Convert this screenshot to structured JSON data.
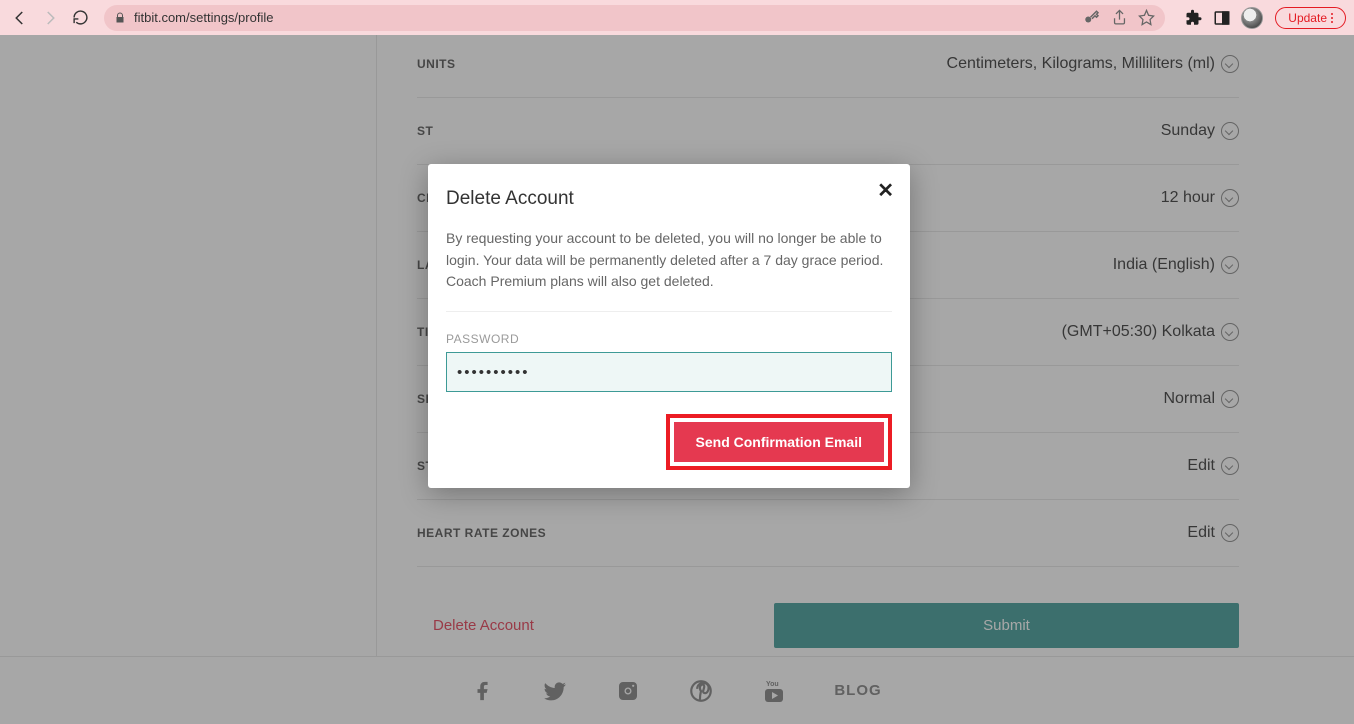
{
  "browser": {
    "url": "fitbit.com/settings/profile",
    "update_label": "Update"
  },
  "settings": [
    {
      "label": "UNITS",
      "value": "Centimeters, Kilograms, Milliliters (ml)"
    },
    {
      "label": "ST",
      "value": "Sunday"
    },
    {
      "label": "CL",
      "value": "12 hour"
    },
    {
      "label": "LA",
      "value": "India (English)"
    },
    {
      "label": "TI",
      "value": "(GMT+05:30) Kolkata"
    },
    {
      "label": "SL",
      "value": "Normal"
    },
    {
      "label": "STRIDE LENGTH",
      "value": "Edit"
    },
    {
      "label": "HEART RATE ZONES",
      "value": "Edit"
    }
  ],
  "actions": {
    "delete_link": "Delete Account",
    "submit_label": "Submit"
  },
  "footer": {
    "blog": "BLOG"
  },
  "modal": {
    "title": "Delete Account",
    "body": "By requesting your account to be deleted, you will no longer be able to login. Your data will be permanently deleted after a 7 day grace period. Coach Premium plans will also get deleted.",
    "password_label": "PASSWORD",
    "password_value": "••••••••••",
    "confirm_label": "Send Confirmation Email"
  }
}
